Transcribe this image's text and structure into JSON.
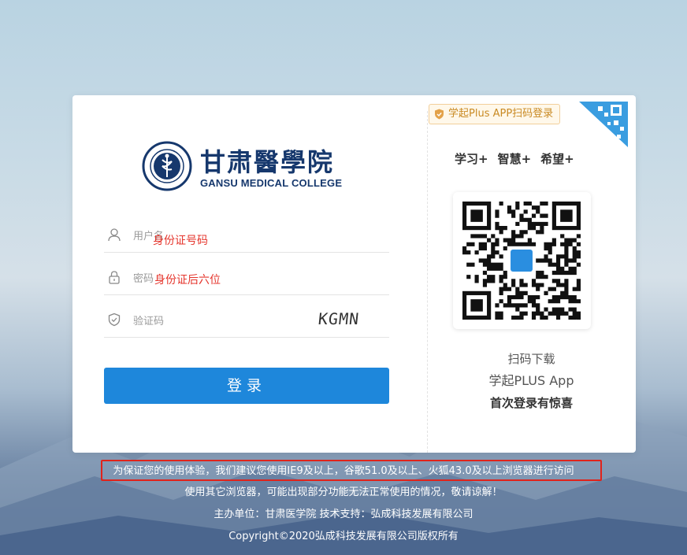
{
  "college": {
    "name_cn": "甘肃醫學院",
    "name_en": "GANSU MEDICAL COLLEGE"
  },
  "form": {
    "username_placeholder": "用户名",
    "username_hint": "身份证号码",
    "password_placeholder": "密码",
    "password_hint": "身份证后六位",
    "captcha_placeholder": "验证码",
    "captcha_text": "KGMN",
    "login_label": "登录"
  },
  "app": {
    "badge_label": "学起Plus APP扫码登录",
    "slogans": [
      "学习+",
      "智慧+",
      "希望+"
    ],
    "download_line1": "扫码下载",
    "download_line2": "学起PLUS App",
    "download_line3": "首次登录有惊喜"
  },
  "footer": {
    "notice": "为保证您的使用体验，我们建议您使用IE9及以上，谷歌51.0及以上、火狐43.0及以上浏览器进行访问",
    "warning": "使用其它浏览器，可能出现部分功能无法正常使用的情况，敬请谅解！",
    "host": "主办单位：甘肃医学院  技术支持：弘成科技发展有限公司",
    "copyright": "Copyright©2020弘成科技发展有限公司版权所有"
  },
  "colors": {
    "primary": "#1e87db",
    "brand_navy": "#16386d",
    "hint_red": "#e5352c",
    "badge_orange": "#c98a23",
    "highlight_red": "#e0231b"
  },
  "icons": {
    "user": "user-icon",
    "lock": "lock-icon",
    "shield": "shield-check-icon",
    "qr": "qr-code-icon"
  }
}
